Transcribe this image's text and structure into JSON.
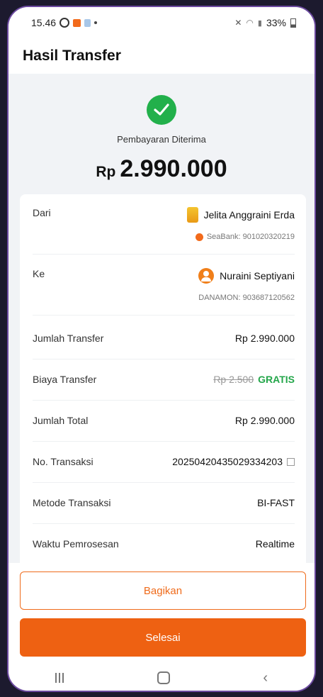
{
  "status_bar": {
    "time": "15.46",
    "battery": "33%"
  },
  "app_bar": {
    "title": "Hasil Transfer"
  },
  "hero": {
    "status_label": "Pembayaran Diterima",
    "currency": "Rp",
    "amount": "2.990.000"
  },
  "details": {
    "from": {
      "label": "Dari",
      "name": "Jelita Anggraini Erda",
      "account": "SeaBank: 901020320219"
    },
    "to": {
      "label": "Ke",
      "name": "Nuraini Septiyani",
      "account": "DANAMON: 903687120562"
    },
    "transfer_amount": {
      "label": "Jumlah Transfer",
      "value": "Rp 2.990.000"
    },
    "fee": {
      "label": "Biaya Transfer",
      "original": "Rp 2.500",
      "value": "GRATIS"
    },
    "total": {
      "label": "Jumlah Total",
      "value": "Rp 2.990.000"
    },
    "transaction_no": {
      "label": "No. Transaksi",
      "value": "20250420435029334203"
    },
    "method": {
      "label": "Metode Transaksi",
      "value": "BI-FAST"
    },
    "processing_time": {
      "label": "Waktu Pemrosesan",
      "value": "Realtime"
    }
  },
  "actions": {
    "share_label": "Bagikan",
    "done_label": "Selesai"
  },
  "colors": {
    "accent": "#ee6112",
    "success": "#22b04b",
    "free": "#23a64a"
  }
}
